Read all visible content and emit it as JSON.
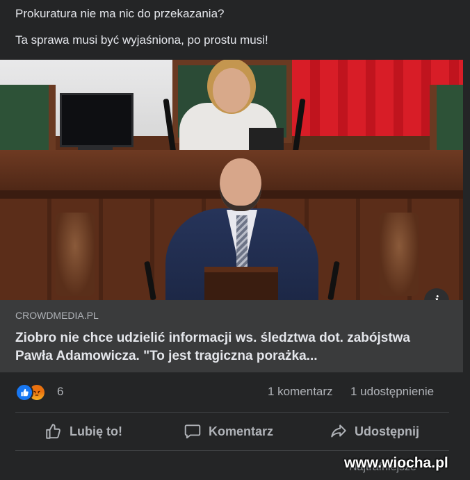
{
  "post": {
    "line1": "Prokuratura nie ma nic do przekazania?",
    "line2": "Ta sprawa musi być wyjaśniona, po prostu musi!"
  },
  "link_preview": {
    "domain": "CROWDMEDIA.PL",
    "title": "Ziobro nie chce udzielić informacji ws. śledztwa dot. zabójstwa Pawła Adamowicza. \"To jest tragiczna porażka...",
    "info_icon": "info-icon",
    "info_glyph": "i"
  },
  "stats": {
    "reaction_icons": [
      "like-reaction-icon",
      "angry-reaction-icon"
    ],
    "reaction_count": "6",
    "comments": "1 komentarz",
    "shares": "1 udostępnienie"
  },
  "actions": {
    "like": "Lubię to!",
    "comment": "Komentarz",
    "share": "Udostępnij"
  },
  "footer": {
    "sort_label": "Najtrafniejsze",
    "watermark": "www.wiocha.pl"
  },
  "colors": {
    "background": "#242526",
    "link_box": "#3a3b3c",
    "like_blue": "#1877f2",
    "text_primary": "#e4e6eb",
    "text_secondary": "#b0b3b8"
  }
}
